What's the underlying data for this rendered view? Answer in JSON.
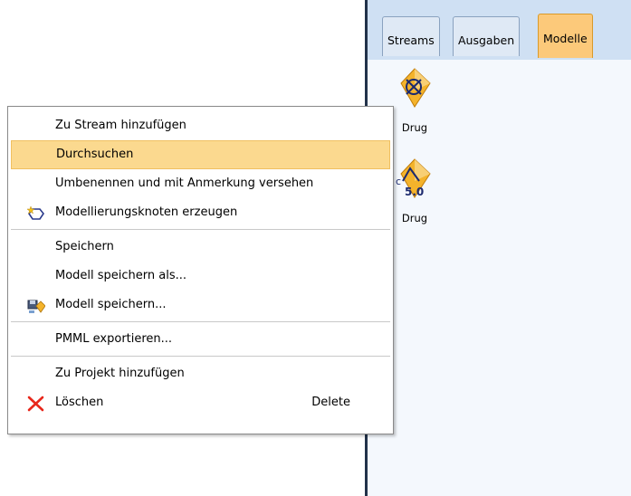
{
  "tabs": [
    {
      "label": "Streams",
      "active": false
    },
    {
      "label": "Ausgaben",
      "active": false
    },
    {
      "label": "Modelle",
      "active": true
    }
  ],
  "models": [
    {
      "label": "Drug",
      "icon": "model-nugget-icon"
    },
    {
      "label": "Drug",
      "icon": "c50-model-nugget-icon",
      "badge": "5.0"
    }
  ],
  "menu": {
    "items": [
      {
        "label": "Zu Stream hinzufügen"
      },
      {
        "label": "Durchsuchen",
        "highlighted": true
      },
      {
        "label": "Umbenennen und mit Anmerkung versehen"
      },
      {
        "label": "Modellierungsknoten erzeugen",
        "icon": "generate-node-icon"
      },
      {
        "label": "Speichern"
      },
      {
        "label": "Modell speichern als..."
      },
      {
        "label": "Modell speichern...",
        "icon": "save-model-icon"
      },
      {
        "label": "PMML exportieren..."
      },
      {
        "label": "Zu Projekt hinzufügen"
      },
      {
        "label": "Löschen",
        "icon": "delete-x-icon",
        "shortcut": "Delete"
      }
    ]
  },
  "colors": {
    "highlight": "#fbd98f",
    "active_tab": "#fcc97a",
    "delete_icon": "#e8271b",
    "nugget": "#f4b32b"
  }
}
